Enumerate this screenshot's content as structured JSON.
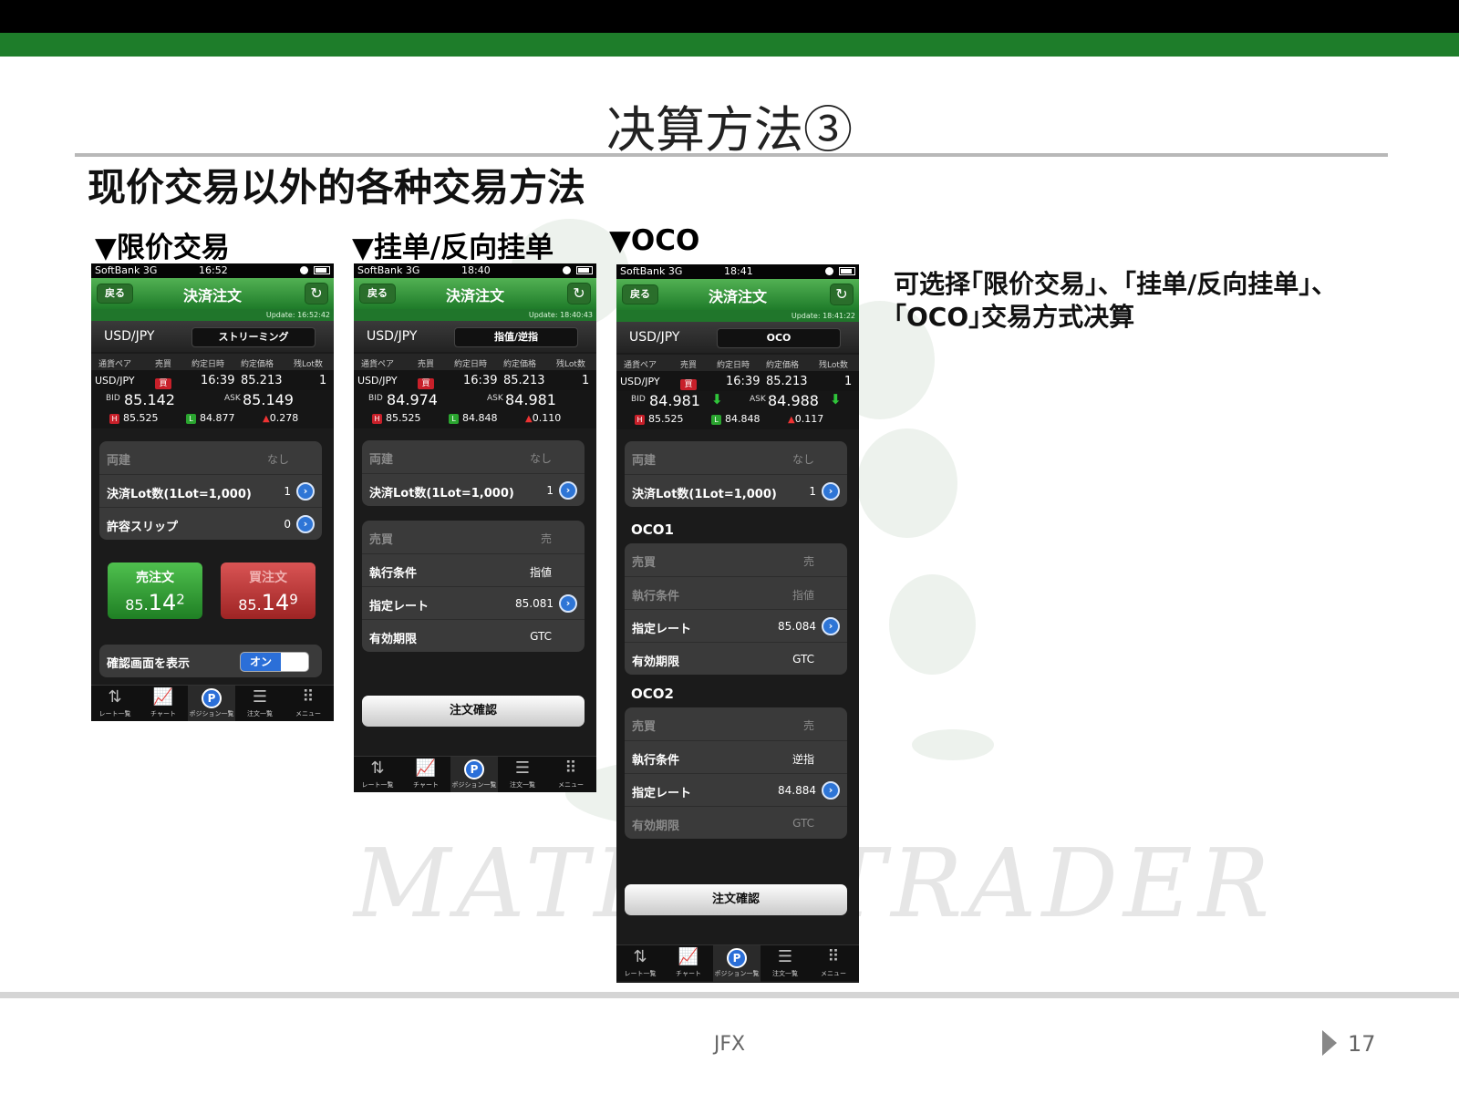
{
  "slide": {
    "title": "决算方法③",
    "subtitle": "现价交易以外的各种交易方法",
    "labels": [
      "▼限价交易",
      "▼挂单/反向挂单",
      "▼OCO"
    ],
    "side_text": "可选择｢限价交易｣、｢挂单/反向挂单｣、｢OCO｣交易方式决算",
    "watermark": "MATRIX TRADER",
    "footer_center": "JFX",
    "page_number": "17"
  },
  "common": {
    "carrier": "SoftBank  3G",
    "back": "戻る",
    "nav_title": "決済注文",
    "refresh": "↻",
    "pair": "USD/JPY",
    "columns": [
      "通貨ペア",
      "売買",
      "約定日時",
      "約定価格",
      "残Lot数"
    ],
    "row": {
      "pair": "USD/JPY",
      "side": "買",
      "time": "16:39",
      "price": "85.213",
      "lots": "1"
    },
    "bid_label": "BID",
    "ask_label": "ASK",
    "h_label": "H",
    "l_label": "L",
    "h_value": "85.525",
    "ryodate_key": "両建",
    "ryodate_val": "なし",
    "lot_key": "決済Lot数(1Lot=1,000)",
    "lot_val": "1",
    "confirm": "注文確認",
    "tabs": [
      "レート一覧",
      "チャート",
      "ポジション一覧",
      "注文一覧",
      "メニュー"
    ]
  },
  "phone1": {
    "time": "16:52",
    "update": "Update: 16:52:42",
    "mode": "ストリーミング",
    "bid": "85.142",
    "ask": "85.149",
    "low": "84.877",
    "change": "0.278",
    "slip_key": "許容スリップ",
    "slip_val": "0",
    "sell_label": "売注文",
    "sell_price_a": "85.",
    "sell_price_b": "14",
    "sell_price_c": "2",
    "buy_label": "買注文",
    "buy_price_a": "85.",
    "buy_price_b": "14",
    "buy_price_c": "9",
    "confirm_key": "確認画面を表示",
    "toggle_on": "オン"
  },
  "phone2": {
    "time": "18:40",
    "update": "Update: 18:40:43",
    "mode": "指值/逆指",
    "bid": "84.974",
    "ask": "84.981",
    "low": "84.848",
    "change": "0.110",
    "rows": [
      {
        "k": "売買",
        "v": "売"
      },
      {
        "k": "執行条件",
        "v": "指値"
      },
      {
        "k": "指定レート",
        "v": "85.081"
      },
      {
        "k": "有効期限",
        "v": "GTC"
      }
    ]
  },
  "phone3": {
    "time": "18:41",
    "update": "Update: 18:41:22",
    "mode": "OCO",
    "bid": "84.981",
    "ask": "84.988",
    "low": "84.848",
    "change": "0.117",
    "oco1_title": "OCO1",
    "oco1": [
      {
        "k": "売買",
        "v": "売"
      },
      {
        "k": "執行条件",
        "v": "指値"
      },
      {
        "k": "指定レート",
        "v": "85.084"
      },
      {
        "k": "有効期限",
        "v": "GTC"
      }
    ],
    "oco2_title": "OCO2",
    "oco2": [
      {
        "k": "売買",
        "v": "売"
      },
      {
        "k": "執行条件",
        "v": "逆指"
      },
      {
        "k": "指定レート",
        "v": "84.884"
      },
      {
        "k": "有効期限",
        "v": "GTC"
      }
    ]
  },
  "colors": {
    "green_bar": "#1e7d2a",
    "sell_green": "#2e9a34",
    "buy_red": "#c23a3a",
    "blue_arrow": "#2e75d6"
  }
}
